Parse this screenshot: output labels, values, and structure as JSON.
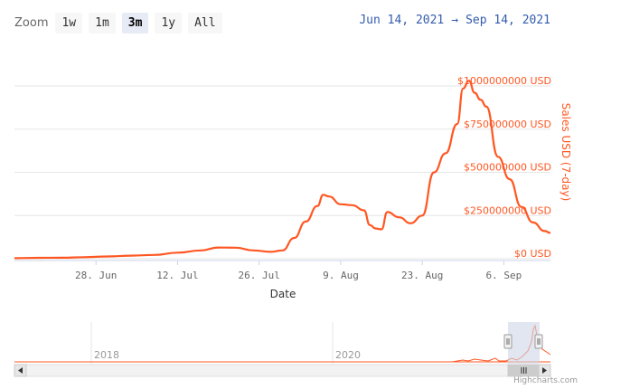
{
  "toolbar": {
    "zoom_label": "Zoom",
    "buttons": [
      "1w",
      "1m",
      "3m",
      "1y",
      "All"
    ],
    "active": "3m"
  },
  "range": {
    "from": "Jun 14, 2021",
    "arrow": "→",
    "to": "Sep 14, 2021"
  },
  "credit": "Highcharts.com",
  "colors": {
    "series": "#ff5722",
    "axis_text": "#ff5722",
    "grid": "#e6e6e6",
    "navigator_mask": "#cfd6e6"
  },
  "chart_data": {
    "type": "line",
    "title": "",
    "xlabel": "Date",
    "ylabel": "Sales USD (7-day)",
    "x_ticks": [
      "28. Jun",
      "12. Jul",
      "26. Jul",
      "9. Aug",
      "23. Aug",
      "6. Sep"
    ],
    "y_ticks": [
      "$0 USD",
      "$250000000 USD",
      "$500000000 USD",
      "$750000000 USD",
      "$1000000000 USD"
    ],
    "ylim": [
      0,
      1000000000
    ],
    "xlim": [
      "2021-06-14",
      "2021-09-14"
    ],
    "grid": true,
    "series": [
      {
        "name": "",
        "color": "#ff5722",
        "x": [
          "2021-06-14",
          "2021-06-18",
          "2021-06-22",
          "2021-06-26",
          "2021-06-30",
          "2021-07-04",
          "2021-07-08",
          "2021-07-12",
          "2021-07-16",
          "2021-07-19",
          "2021-07-22",
          "2021-07-25",
          "2021-07-28",
          "2021-07-30",
          "2021-08-01",
          "2021-08-03",
          "2021-08-05",
          "2021-08-06",
          "2021-08-07",
          "2021-08-09",
          "2021-08-11",
          "2021-08-13",
          "2021-08-14",
          "2021-08-15",
          "2021-08-16",
          "2021-08-17",
          "2021-08-19",
          "2021-08-21",
          "2021-08-23",
          "2021-08-25",
          "2021-08-27",
          "2021-08-29",
          "2021-08-30",
          "2021-08-31",
          "2021-09-01",
          "2021-09-02",
          "2021-09-03",
          "2021-09-05",
          "2021-09-07",
          "2021-09-09",
          "2021-09-11",
          "2021-09-13",
          "2021-09-14"
        ],
        "y": [
          3000000,
          5000000,
          6000000,
          9000000,
          13000000,
          18000000,
          22000000,
          35000000,
          48000000,
          65000000,
          64000000,
          48000000,
          40000000,
          48000000,
          120000000,
          215000000,
          305000000,
          370000000,
          360000000,
          315000000,
          310000000,
          280000000,
          195000000,
          175000000,
          170000000,
          270000000,
          240000000,
          205000000,
          250000000,
          500000000,
          610000000,
          780000000,
          985000000,
          1030000000,
          960000000,
          920000000,
          880000000,
          590000000,
          460000000,
          300000000,
          210000000,
          160000000,
          150000000
        ]
      }
    ]
  },
  "navigator": {
    "labels": [
      "2018",
      "2020"
    ]
  }
}
